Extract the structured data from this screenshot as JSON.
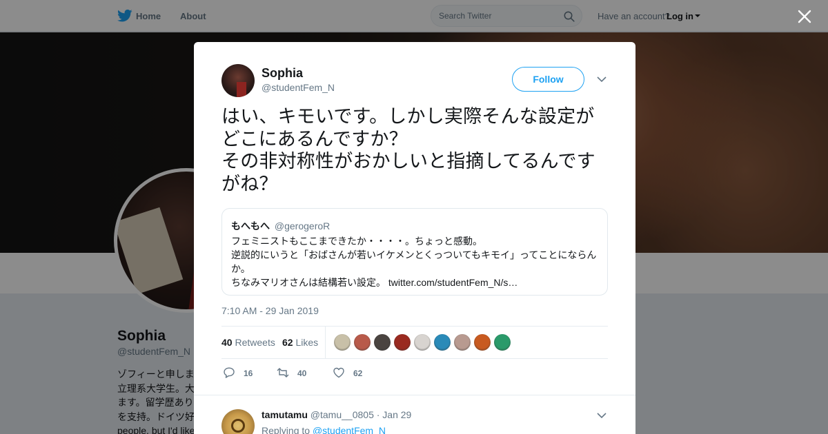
{
  "topbar": {
    "home_label": "Home",
    "about_label": "About",
    "search_placeholder": "Search Twitter",
    "account_prompt": "Have an account?",
    "login_label": "Log in"
  },
  "profile": {
    "name": "Sophia",
    "handle": "@studentFem_N",
    "bio": "ゾフィーと申しま\n立理系大学生。大\nます。留学歴あり\nを支持。ドイツ好\npeople, but I'd like"
  },
  "tweet": {
    "author_name": "Sophia",
    "author_handle": "@studentFem_N",
    "follow_label": "Follow",
    "text_lines": [
      "はい、キモいです。しかし実際そんな設定が",
      "どこにあるんですか？",
      "その非対称性がおかしいと指摘してるんです",
      "がね？"
    ],
    "quote": {
      "name": "もへもへ",
      "handle": "@gerogeroR",
      "lines": [
        "フェミニストもここまできたか・・・・。ちょっと感動。",
        "逆説的にいうと「おばさんが若いイケメンとくっついてもキモイ」ってことにならん",
        "か。",
        "ちなみマリオさんは結構若い設定。"
      ],
      "link": "twitter.com/studentFem_N/s…"
    },
    "timestamp": "7:10 AM - 29 Jan 2019",
    "retweets_count": "40",
    "retweets_label": "Retweets",
    "likes_count": "62",
    "likes_label": "Likes",
    "liker_colors": [
      "#c8c0a8",
      "#b85a4a",
      "#4a4440",
      "#9a2a20",
      "#d8d4d0",
      "#2a8ab8",
      "#b89a90",
      "#c85a20",
      "#2a9a6a"
    ],
    "actions": {
      "replies": "16",
      "retweets": "40",
      "likes": "62"
    }
  },
  "reply": {
    "name": "tamutamu",
    "handle": "@tamu__0805",
    "time": "· Jan 29",
    "replying_prefix": "Replying to",
    "replying_handle": "@studentFem_N"
  },
  "colors": {
    "brand": "#1da1f2",
    "text": "#14171a",
    "muted": "#657786"
  }
}
